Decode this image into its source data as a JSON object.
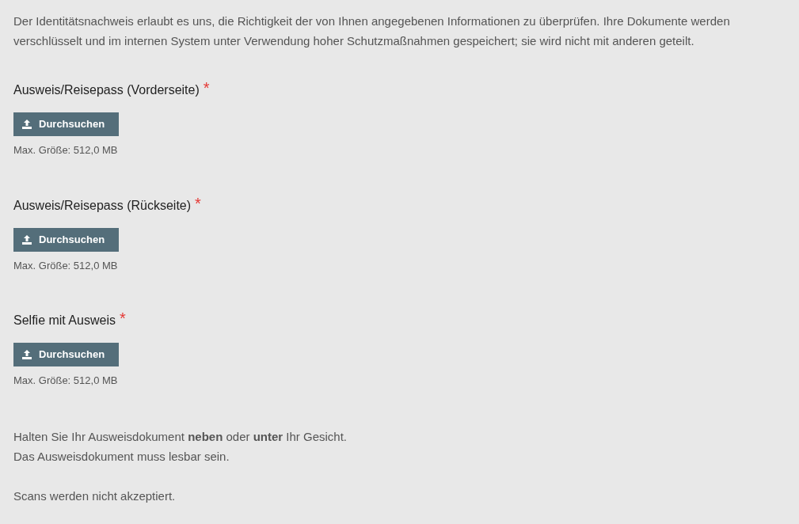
{
  "intro": "Der Identitätsnachweis erlaubt es uns, die Richtigkeit der von Ihnen angegebenen Informationen zu überprüfen. Ihre Dokumente werden verschlüsselt und im internen System unter Verwendung hoher Schutzmaßnahmen gespeichert; sie wird nicht mit anderen geteilt.",
  "uploads": [
    {
      "label": "Ausweis/Reisepass (Vorderseite)",
      "required": true,
      "required_mark": "*",
      "button": "Durchsuchen",
      "hint": "Max. Größe: 512,0 MB"
    },
    {
      "label": "Ausweis/Reisepass (Rückseite)",
      "required": true,
      "required_mark": "*",
      "button": "Durchsuchen",
      "hint": "Max. Größe: 512,0 MB"
    },
    {
      "label": "Selfie mit Ausweis",
      "required": true,
      "required_mark": "*",
      "button": "Durchsuchen",
      "hint": "Max. Größe: 512,0 MB"
    }
  ],
  "notes": [
    [
      "Halten Sie Ihr Ausweisdokument **neben** oder **unter** Ihr Gesicht.",
      "Das Ausweisdokument muss lesbar sein."
    ],
    [
      "Scans werden nicht akzeptiert."
    ]
  ]
}
